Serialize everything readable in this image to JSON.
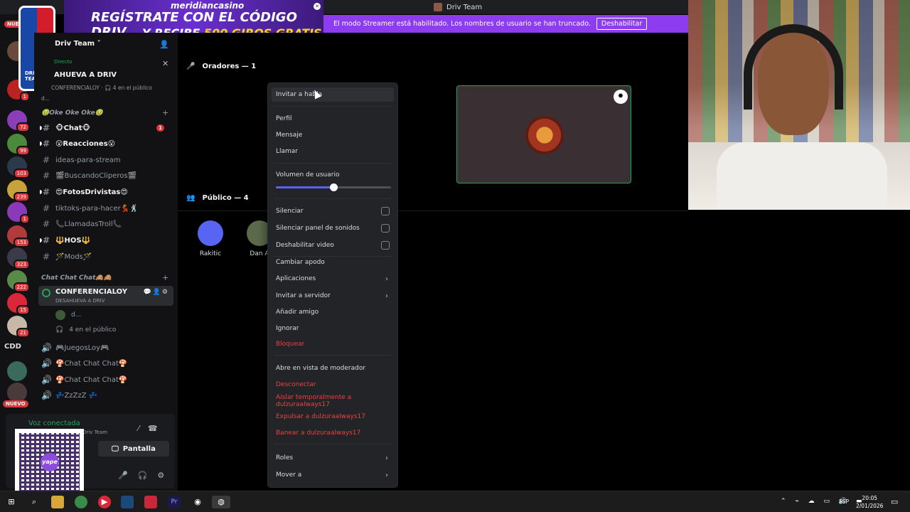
{
  "window": {
    "title": "Driv Team"
  },
  "ad": {
    "brand": "meridiancasino",
    "line1": "REGÍSTRATE CON EL CÓDIGO",
    "code": "DRIV",
    "line2_prefix": "Y RECIBE",
    "line2_highlight": "500 GIROS GRATIS"
  },
  "logo": {
    "text": "DRIV TEAM"
  },
  "banner": {
    "message": "El modo Streamer está habilitado. Los nombres de usuario se han truncado.",
    "button": "Deshabilitar"
  },
  "servers": {
    "top_pill": "NUE",
    "badges": [
      "1",
      "72",
      "99",
      "103",
      "239",
      "1",
      "153",
      "323",
      "222",
      "15",
      "21"
    ],
    "text_item": "CDD",
    "bottom_pill": "NUEVO"
  },
  "sidebar": {
    "server_name": "Driv Team",
    "live": {
      "tag": "Directo",
      "title": "AHUEVA A DRIV",
      "subtitle": "CONFERENCIALOY · 🎧 4 en el público",
      "user": "d..."
    },
    "category1": "🤢Oke Oke Oke🤢",
    "channels1": [
      {
        "name": "🐵Chat🐵",
        "unread": "1"
      },
      {
        "name": "😮Reacciones😮"
      },
      {
        "name": "ideas-para-stream"
      },
      {
        "name": "🎬BuscandoCliperos🎬"
      },
      {
        "name": "😍FotosDrivistas😍"
      },
      {
        "name": "tiktoks-para-hacer💃🕺"
      },
      {
        "name": "📞LlamadasTroll📞"
      },
      {
        "name": "🔱HOS🔱"
      },
      {
        "name": "🪄Mods🪄"
      }
    ],
    "category2": "Chat Chat Chat🙈🙈",
    "stage_channel": {
      "name": "CONFERENCIALOY",
      "topic": "DESAHUEVA A DRIV"
    },
    "stage_users": [
      {
        "name": "d..."
      },
      {
        "name": "4 en el público"
      }
    ],
    "channels2": [
      {
        "name": "🎮JuegosLoy🎮"
      },
      {
        "name": "🍄Chat Chat Chat🍄"
      },
      {
        "name": "🍄Chat Chat Chat🍄"
      },
      {
        "name": "💤ZzZzZ 💤"
      }
    ]
  },
  "voice_panel": {
    "status": "Voz conectada",
    "server": "Driv Team",
    "screen_button": "Pantalla"
  },
  "qr": {
    "brand": "yape"
  },
  "stage": {
    "speakers_header": "Oradores — 1",
    "audience_header": "Público — 4",
    "audience": [
      {
        "name": "Rakitic"
      },
      {
        "name": "Dan A"
      }
    ]
  },
  "context_menu": {
    "invite": "Invitar a habla",
    "group1": [
      "Perfil",
      "Mensaje",
      "Llamar"
    ],
    "volume_label": "Volumen de usuario",
    "volume_level": 0.5,
    "checks": [
      "Silenciar",
      "Silenciar panel de sonidos",
      "Deshabilitar video"
    ],
    "group3": [
      {
        "label": "Cambiar apodo"
      },
      {
        "label": "Aplicaciones",
        "sub": true
      },
      {
        "label": "Invitar a servidor",
        "sub": true
      },
      {
        "label": "Añadir amigo"
      },
      {
        "label": "Ignorar"
      },
      {
        "label": "Bloquear",
        "danger": true
      }
    ],
    "group4": [
      {
        "label": "Abre en vista de moderador"
      },
      {
        "label": "Desconectar",
        "danger": true
      },
      {
        "label": "Aislar temporalmente a dulzuraalways17",
        "danger": true
      },
      {
        "label": "Expulsar a dulzuraalways17",
        "danger": true
      },
      {
        "label": "Banear a dulzuraalways17",
        "danger": true
      }
    ],
    "group5": [
      {
        "label": "Roles",
        "sub": true
      },
      {
        "label": "Mover a",
        "sub": true
      }
    ]
  },
  "taskbar": {
    "lang": "ESP",
    "time": "20:05",
    "date": "2/01/2026"
  },
  "colors": {
    "accent": "#5865f2",
    "danger": "#f23f42",
    "online": "#23a55a",
    "banner": "#8d3cf0"
  }
}
